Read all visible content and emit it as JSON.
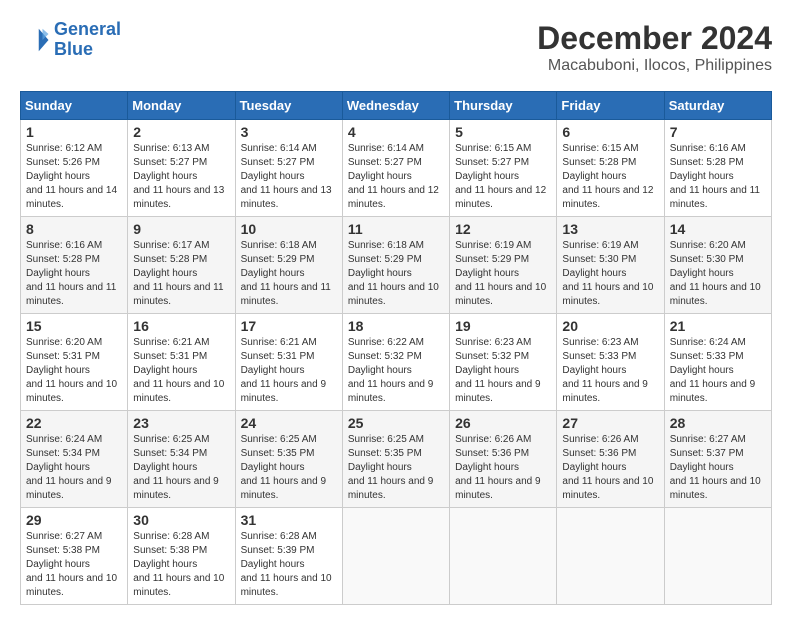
{
  "header": {
    "logo_line1": "General",
    "logo_line2": "Blue",
    "month_title": "December 2024",
    "location": "Macabuboni, Ilocos, Philippines"
  },
  "weekdays": [
    "Sunday",
    "Monday",
    "Tuesday",
    "Wednesday",
    "Thursday",
    "Friday",
    "Saturday"
  ],
  "weeks": [
    [
      {
        "day": "1",
        "sunrise": "6:12 AM",
        "sunset": "5:26 PM",
        "daylight": "11 hours and 14 minutes."
      },
      {
        "day": "2",
        "sunrise": "6:13 AM",
        "sunset": "5:27 PM",
        "daylight": "11 hours and 13 minutes."
      },
      {
        "day": "3",
        "sunrise": "6:14 AM",
        "sunset": "5:27 PM",
        "daylight": "11 hours and 13 minutes."
      },
      {
        "day": "4",
        "sunrise": "6:14 AM",
        "sunset": "5:27 PM",
        "daylight": "11 hours and 12 minutes."
      },
      {
        "day": "5",
        "sunrise": "6:15 AM",
        "sunset": "5:27 PM",
        "daylight": "11 hours and 12 minutes."
      },
      {
        "day": "6",
        "sunrise": "6:15 AM",
        "sunset": "5:28 PM",
        "daylight": "11 hours and 12 minutes."
      },
      {
        "day": "7",
        "sunrise": "6:16 AM",
        "sunset": "5:28 PM",
        "daylight": "11 hours and 11 minutes."
      }
    ],
    [
      {
        "day": "8",
        "sunrise": "6:16 AM",
        "sunset": "5:28 PM",
        "daylight": "11 hours and 11 minutes."
      },
      {
        "day": "9",
        "sunrise": "6:17 AM",
        "sunset": "5:28 PM",
        "daylight": "11 hours and 11 minutes."
      },
      {
        "day": "10",
        "sunrise": "6:18 AM",
        "sunset": "5:29 PM",
        "daylight": "11 hours and 11 minutes."
      },
      {
        "day": "11",
        "sunrise": "6:18 AM",
        "sunset": "5:29 PM",
        "daylight": "11 hours and 10 minutes."
      },
      {
        "day": "12",
        "sunrise": "6:19 AM",
        "sunset": "5:29 PM",
        "daylight": "11 hours and 10 minutes."
      },
      {
        "day": "13",
        "sunrise": "6:19 AM",
        "sunset": "5:30 PM",
        "daylight": "11 hours and 10 minutes."
      },
      {
        "day": "14",
        "sunrise": "6:20 AM",
        "sunset": "5:30 PM",
        "daylight": "11 hours and 10 minutes."
      }
    ],
    [
      {
        "day": "15",
        "sunrise": "6:20 AM",
        "sunset": "5:31 PM",
        "daylight": "11 hours and 10 minutes."
      },
      {
        "day": "16",
        "sunrise": "6:21 AM",
        "sunset": "5:31 PM",
        "daylight": "11 hours and 10 minutes."
      },
      {
        "day": "17",
        "sunrise": "6:21 AM",
        "sunset": "5:31 PM",
        "daylight": "11 hours and 9 minutes."
      },
      {
        "day": "18",
        "sunrise": "6:22 AM",
        "sunset": "5:32 PM",
        "daylight": "11 hours and 9 minutes."
      },
      {
        "day": "19",
        "sunrise": "6:23 AM",
        "sunset": "5:32 PM",
        "daylight": "11 hours and 9 minutes."
      },
      {
        "day": "20",
        "sunrise": "6:23 AM",
        "sunset": "5:33 PM",
        "daylight": "11 hours and 9 minutes."
      },
      {
        "day": "21",
        "sunrise": "6:24 AM",
        "sunset": "5:33 PM",
        "daylight": "11 hours and 9 minutes."
      }
    ],
    [
      {
        "day": "22",
        "sunrise": "6:24 AM",
        "sunset": "5:34 PM",
        "daylight": "11 hours and 9 minutes."
      },
      {
        "day": "23",
        "sunrise": "6:25 AM",
        "sunset": "5:34 PM",
        "daylight": "11 hours and 9 minutes."
      },
      {
        "day": "24",
        "sunrise": "6:25 AM",
        "sunset": "5:35 PM",
        "daylight": "11 hours and 9 minutes."
      },
      {
        "day": "25",
        "sunrise": "6:25 AM",
        "sunset": "5:35 PM",
        "daylight": "11 hours and 9 minutes."
      },
      {
        "day": "26",
        "sunrise": "6:26 AM",
        "sunset": "5:36 PM",
        "daylight": "11 hours and 9 minutes."
      },
      {
        "day": "27",
        "sunrise": "6:26 AM",
        "sunset": "5:36 PM",
        "daylight": "11 hours and 10 minutes."
      },
      {
        "day": "28",
        "sunrise": "6:27 AM",
        "sunset": "5:37 PM",
        "daylight": "11 hours and 10 minutes."
      }
    ],
    [
      {
        "day": "29",
        "sunrise": "6:27 AM",
        "sunset": "5:38 PM",
        "daylight": "11 hours and 10 minutes."
      },
      {
        "day": "30",
        "sunrise": "6:28 AM",
        "sunset": "5:38 PM",
        "daylight": "11 hours and 10 minutes."
      },
      {
        "day": "31",
        "sunrise": "6:28 AM",
        "sunset": "5:39 PM",
        "daylight": "11 hours and 10 minutes."
      },
      null,
      null,
      null,
      null
    ]
  ]
}
